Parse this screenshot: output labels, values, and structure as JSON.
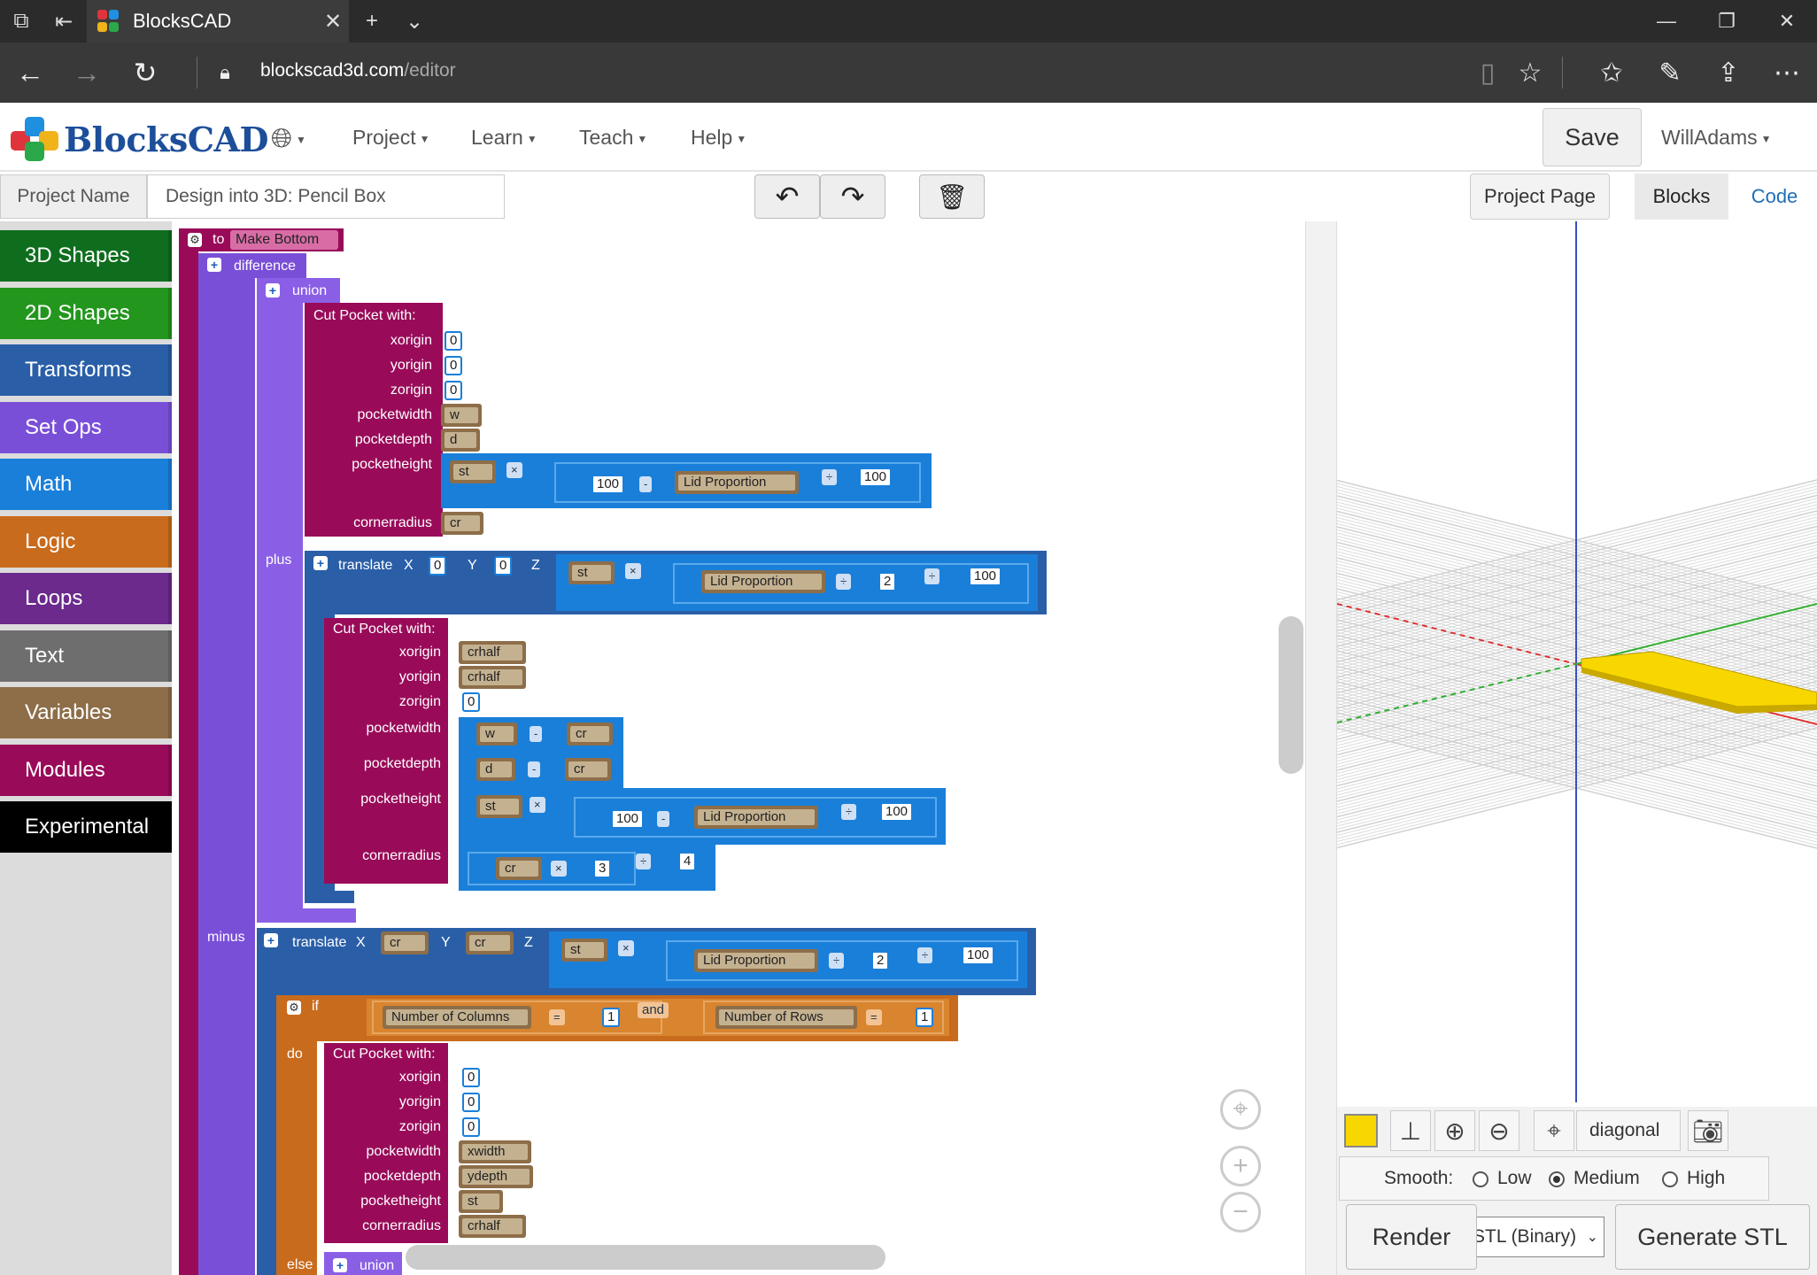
{
  "browser": {
    "tab_title": "BlocksCAD",
    "url_host": "blockscad3d.com",
    "url_path": "/editor"
  },
  "app": {
    "logo_text": "BlocksCAD",
    "menus": [
      "Project",
      "Learn",
      "Teach",
      "Help"
    ],
    "save_label": "Save",
    "user_name": "WillAdams"
  },
  "toolbar": {
    "project_name_label": "Project Name",
    "project_name_value": "Design into 3D: Pencil Box",
    "project_page_label": "Project Page",
    "tab_blocks": "Blocks",
    "tab_code": "Code"
  },
  "categories": [
    {
      "label": "3D Shapes",
      "color": "#0f6e1e"
    },
    {
      "label": "2D Shapes",
      "color": "#23961d"
    },
    {
      "label": "Transforms",
      "color": "#2a5fa8"
    },
    {
      "label": "Set Ops",
      "color": "#7a4fd8"
    },
    {
      "label": "Math",
      "color": "#1a7fd9"
    },
    {
      "label": "Logic",
      "color": "#c96b1c"
    },
    {
      "label": "Loops",
      "color": "#6b2a8c"
    },
    {
      "label": "Text",
      "color": "#6e6e6e"
    },
    {
      "label": "Variables",
      "color": "#8d6e49"
    },
    {
      "label": "Modules",
      "color": "#990b59"
    },
    {
      "label": "Experimental",
      "color": "#000000"
    }
  ],
  "blocks": {
    "to": "to",
    "module_name": "Make Bottom",
    "difference": "difference",
    "union": "union",
    "plus": "plus",
    "minus": "minus",
    "cut_pocket": "Cut Pocket  with:",
    "translate": "translate",
    "x": "X",
    "y": "Y",
    "z": "Z",
    "if": "if",
    "do": "do",
    "else": "else",
    "and": "and",
    "params": [
      "xorigin",
      "yorigin",
      "zorigin",
      "pocketwidth",
      "pocketdepth",
      "pocketheight",
      "cornerradius"
    ],
    "vars": {
      "w": "w",
      "d": "d",
      "st": "st",
      "cr": "cr",
      "crhalf": "crhalf",
      "lid": "Lid Proportion",
      "cols": "Number of Columns",
      "rows": "Number of Rows",
      "xwidth": "xwidth",
      "ydepth": "ydepth"
    },
    "nums": {
      "zero": "0",
      "hundred": "100",
      "two": "2",
      "three": "3",
      "four": "4",
      "one": "1"
    },
    "ops": {
      "times": "×",
      "minus": "-",
      "div": "÷",
      "eq": "="
    }
  },
  "viewer": {
    "view_label": "diagonal",
    "smooth_label": "Smooth:",
    "smooth_options": [
      "Low",
      "Medium",
      "High"
    ],
    "smooth_selected": "Medium",
    "render_label": "Render",
    "format_value": "STL (Binary)",
    "generate_label": "Generate STL",
    "model_color": "#f8d700"
  }
}
